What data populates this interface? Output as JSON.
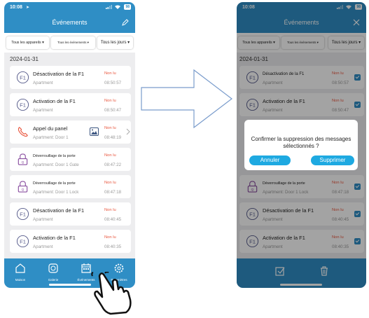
{
  "left": {
    "status_time": "10:08",
    "battery": "98",
    "nav_title": "Événements",
    "filters": [
      "Tous les appareils",
      "Tous les événements",
      "Tous les jours"
    ],
    "date": "2024-01-31",
    "events": [
      {
        "title": "Désactivation de la F1",
        "sub": "Apartment",
        "status": "Non lu",
        "time": "08:50:57",
        "icon": "f1-icon"
      },
      {
        "title": "Activation de la F1",
        "sub": "Apartment",
        "status": "Non lu",
        "time": "08:50:47",
        "icon": "f1-icon"
      },
      {
        "title": "Appel du panel",
        "sub": "Apartment: Door 1",
        "status": "Non lu",
        "time": "08:48:19",
        "icon": "phone-icon"
      },
      {
        "title": "Déverrouillage de la porte",
        "sub": "Apartment: Door 1 Gate",
        "status": "Non lu",
        "time": "08:47:22",
        "icon": "padlock-icon"
      },
      {
        "title": "Déverrouillage de la porte",
        "sub": "Apartment: Door 1 Lock",
        "status": "Non lu",
        "time": "08:47:18",
        "icon": "padlock-icon"
      },
      {
        "title": "Désactivation de la F1",
        "sub": "Apartment",
        "status": "Non lu",
        "time": "08:40:45",
        "icon": "f1-icon"
      },
      {
        "title": "Activation de la F1",
        "sub": "Apartment",
        "status": "Non lu",
        "time": "08:40:35",
        "icon": "f1-icon"
      }
    ],
    "tabs": [
      "Maison",
      "Galerie",
      "Événements",
      "Paramètres"
    ]
  },
  "right": {
    "status_time": "10:08",
    "battery": "98",
    "nav_title": "Événements",
    "filters": [
      "Tous les appareils",
      "Tous les événements",
      "Tous les jours"
    ],
    "date": "2024-01-31",
    "events": [
      {
        "title": "Désactivation de la F1",
        "sub": "Apartment",
        "status": "Non lu",
        "time": "08:50:57"
      },
      {
        "title": "Activation de la F1",
        "sub": "Apartment",
        "status": "Non lu",
        "time": "08:50:47"
      },
      {
        "title": "Déverrouillage de la porte",
        "sub": "Apartment: Door 1 Lock",
        "status": "Non lu",
        "time": "08:47:18"
      },
      {
        "title": "Désactivation de la F1",
        "sub": "Apartment",
        "status": "Non lu",
        "time": "08:40:45"
      },
      {
        "title": "Activation de la F1",
        "sub": "Apartment",
        "status": "Non lu",
        "time": "08:40:35"
      }
    ],
    "dialog": {
      "message": "Confirmer la suppression des messages sélectionnés ?",
      "cancel": "Annuler",
      "confirm": "Supprimer"
    }
  },
  "colors": {
    "primary": "#2f8ec5",
    "unread": "#e9573f",
    "dialog_button": "#1ea9e1"
  }
}
